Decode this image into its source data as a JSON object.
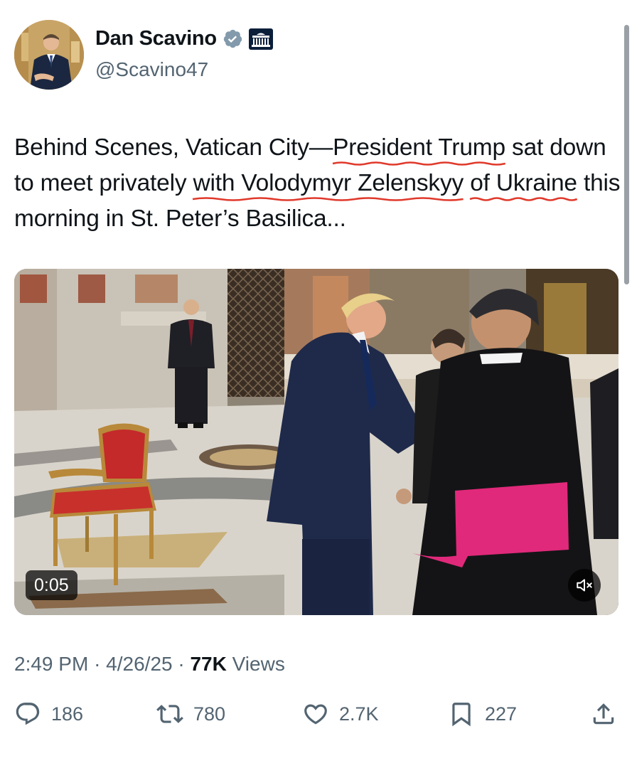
{
  "author": {
    "name": "Dan Scavino",
    "handle": "@Scavino47"
  },
  "tweet": {
    "text_parts": [
      "Behind Scenes, Vatican City—",
      "President Trump",
      " sat down to meet privately ",
      "with Volodymyr Zelenskyy",
      " ",
      "of Ukraine",
      " this morning in St. Peter’s Basilica..."
    ],
    "underline_color": "#e0392b"
  },
  "video": {
    "timestamp": "0:05"
  },
  "meta": {
    "time": "2:49 PM",
    "date": "4/26/25",
    "separator": "·",
    "views_count": "77K",
    "views_label": "Views"
  },
  "actions": {
    "replies": "186",
    "reposts": "780",
    "likes": "2.7K",
    "bookmarks": "227"
  },
  "colors": {
    "verified": "#829aab",
    "text": "#0f1419",
    "muted": "#536471"
  }
}
